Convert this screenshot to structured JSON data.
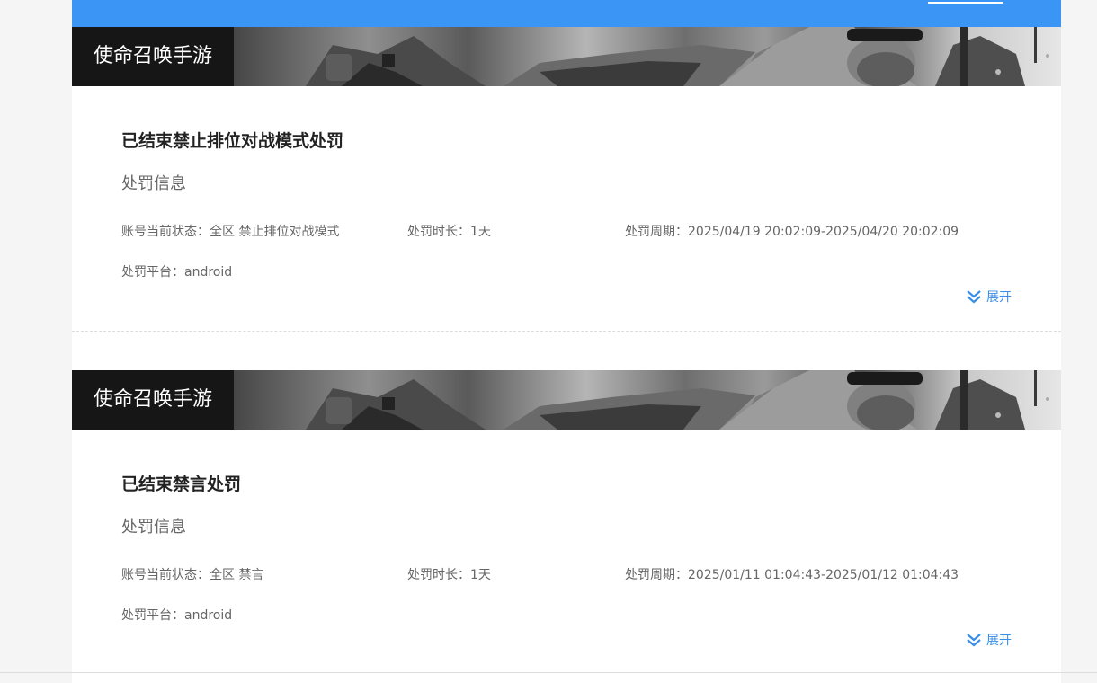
{
  "header": {
    "link_label": "",
    "accent_color": "#3a95f5"
  },
  "records": [
    {
      "game_name": "使命召唤手游",
      "title": "已结束禁止排位对战模式处罚",
      "section_label": "处罚信息",
      "status_label": "账号当前状态：",
      "status_value": "全区 禁止排位对战模式",
      "duration_label": "处罚时长：",
      "duration_value": "1天",
      "period_label": "处罚周期：",
      "period_value": "2025/04/19 20:02:09-2025/04/20 20:02:09",
      "platform_label": "处罚平台：",
      "platform_value": "android",
      "expand_label": "展开"
    },
    {
      "game_name": "使命召唤手游",
      "title": "已结束禁言处罚",
      "section_label": "处罚信息",
      "status_label": "账号当前状态：",
      "status_value": "全区 禁言",
      "duration_label": "处罚时长：",
      "duration_value": "1天",
      "period_label": "处罚周期：",
      "period_value": "2025/01/11 01:04:43-2025/01/12 01:04:43",
      "platform_label": "处罚平台：",
      "platform_value": "android",
      "expand_label": "展开"
    }
  ],
  "icons": {
    "expand": "double-chevron-down-icon"
  }
}
